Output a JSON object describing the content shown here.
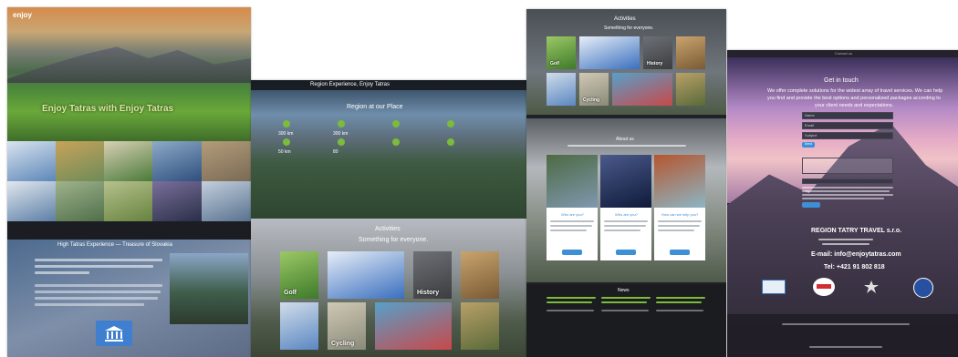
{
  "panel1": {
    "logo": "enjoy",
    "hero_title": "Enjoy Tatras with Enjoy Tatras",
    "tiles": [
      {
        "label": "",
        "c1": "#5c87b8",
        "c2": "#d9e3ef"
      },
      {
        "label": "",
        "c1": "#6e8b58",
        "c2": "#c7a35b"
      },
      {
        "label": "",
        "c1": "#4b7a3a",
        "c2": "#d8d0b5"
      },
      {
        "label": "",
        "c1": "#2f4f7d",
        "c2": "#8daac9"
      },
      {
        "label": "",
        "c1": "#7a6a55",
        "c2": "#b39c7a"
      },
      {
        "label": "",
        "c1": "#5c7fa6",
        "c2": "#e1e7ef"
      },
      {
        "label": "",
        "c1": "#4f6f4a",
        "c2": "#9fb38c"
      },
      {
        "label": "",
        "c1": "#66833f",
        "c2": "#b6c18c"
      },
      {
        "label": "",
        "c1": "#2a2f48",
        "c2": "#7a6f9c"
      },
      {
        "label": "",
        "c1": "#58728f",
        "c2": "#c3cfdc"
      }
    ],
    "about_heading": "High Tatras Experience — Treasure of Slovakia"
  },
  "panel2": {
    "nav_text": "Region Experience, Enjoy Tatras",
    "region_title": "Region at our Place",
    "stats": [
      {
        "value": "300 km",
        "caption": ""
      },
      {
        "value": "300 km",
        "caption": ""
      },
      {
        "value": "",
        "caption": ""
      },
      {
        "value": "50 km",
        "caption": ""
      },
      {
        "value": "80",
        "caption": ""
      },
      {
        "value": "",
        "caption": ""
      }
    ],
    "activities_title": "Activities",
    "activities_subtitle": "Something for everyone.",
    "activities": [
      {
        "label": "Golf",
        "c1": "#3d7a2a",
        "c2": "#9cc865"
      },
      {
        "label": "",
        "c1": "#3a6fbf",
        "c2": "#e7eef7"
      },
      {
        "label": "History",
        "c1": "#3b3d40",
        "c2": "#6d7075"
      },
      {
        "label": "",
        "c1": "#7a5a35",
        "c2": "#c9a46e"
      },
      {
        "label": "",
        "c1": "#5b87c2",
        "c2": "#d0dde9"
      },
      {
        "label": "Cycling",
        "c1": "#8a8a7a",
        "c2": "#cfc9b4"
      },
      {
        "label": "",
        "c1": "#c9484a",
        "c2": "#57a0c9"
      },
      {
        "label": "",
        "c1": "#5a6a3a",
        "c2": "#b9a068"
      }
    ]
  },
  "panel3": {
    "activities_title": "Activities",
    "activities_subtitle": "Something for everyone.",
    "activities": [
      {
        "label": "Golf",
        "c1": "#3d7a2a",
        "c2": "#9cc865"
      },
      {
        "label": "",
        "c1": "#3a6fbf",
        "c2": "#e7eef7"
      },
      {
        "label": "History",
        "c1": "#3b3d40",
        "c2": "#6d7075"
      },
      {
        "label": "",
        "c1": "#7a5a35",
        "c2": "#c9a46e"
      },
      {
        "label": "",
        "c1": "#5b87c2",
        "c2": "#d0dde9"
      },
      {
        "label": "Cycling",
        "c1": "#8a8a7a",
        "c2": "#cfc9b4"
      },
      {
        "label": "",
        "c1": "#c9484a",
        "c2": "#57a0c9"
      },
      {
        "label": "",
        "c1": "#5a6a3a",
        "c2": "#b9a068"
      }
    ],
    "about_title": "About us",
    "photos": [
      {
        "c1": "#7f98b0",
        "c2": "#4d6a43"
      },
      {
        "c1": "#0f1a3a",
        "c2": "#4a5a8a"
      },
      {
        "c1": "#8cb6c5",
        "c2": "#b5562f"
      }
    ],
    "cards": [
      {
        "title": "Who are you?"
      },
      {
        "title": "Who are you?"
      },
      {
        "title": "How can we help you?"
      }
    ],
    "news_title": "News"
  },
  "panel4": {
    "header": "Contact us",
    "get_in_touch": "Get in touch",
    "intro_line1": "We offer complete solutions for the widest array of travel services. We can help",
    "intro_line2": "you find and provide the best options and personalized packages according to",
    "intro_line3": "your client needs and expectations.",
    "form_fields": [
      "Name",
      "Email",
      "Subject"
    ],
    "send_label": "Send",
    "company": "REGION TATRY TRAVEL s.r.o.",
    "email_line": "E-mail: info@enjoytatras.com",
    "phone_line": "Tel: +421 91 802 818",
    "partners": [
      {
        "name": "Tatry logo",
        "color": "#2f6fb8"
      },
      {
        "name": "Tip Tour",
        "color": "#d12f2f"
      },
      {
        "name": "Spiski Tatry",
        "color": "#e0e0e0"
      },
      {
        "name": "Best Tatras",
        "color": "#2850a0"
      }
    ]
  },
  "accent_green": "#7cbb3c",
  "accent_blue": "#3d8fd6"
}
